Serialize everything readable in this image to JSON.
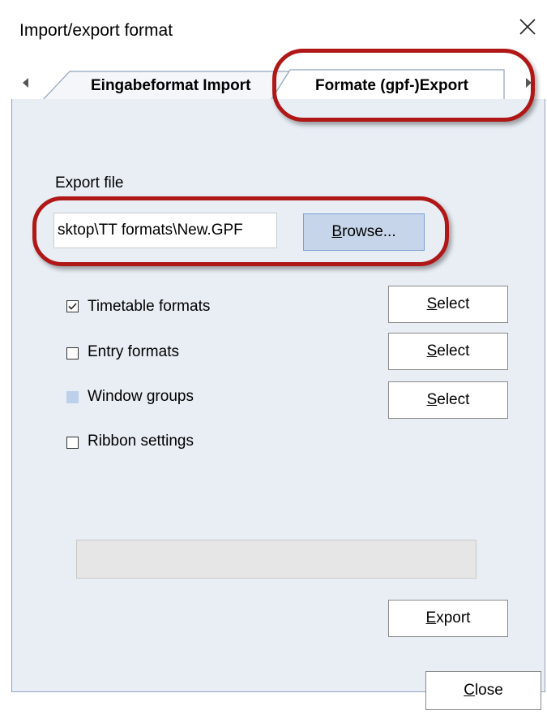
{
  "window": {
    "title": "Import/export format"
  },
  "tabs": [
    {
      "label": "Eingabeformat Import",
      "selected": false
    },
    {
      "label": "Formate (gpf-)Export",
      "selected": true
    }
  ],
  "export_file": {
    "label": "Export file",
    "value": "sktop\\TT formats\\New.GPF",
    "browse_pre": "B",
    "browse_rest": "rowse..."
  },
  "options": [
    {
      "label": "Timetable formats",
      "state": "checked",
      "has_select": true
    },
    {
      "label": "Entry formats",
      "state": "unchecked",
      "has_select": true
    },
    {
      "label": "Window groups",
      "state": "indeterminate",
      "has_select": true
    },
    {
      "label": "Ribbon settings",
      "state": "unchecked",
      "has_select": false
    }
  ],
  "select_button": {
    "pre": "S",
    "rest": "elect"
  },
  "export_button": {
    "pre": "E",
    "rest": "xport"
  },
  "close_button": {
    "pre": "C",
    "rest": "lose"
  },
  "icons": {
    "close": "close-icon",
    "tab_left": "chevron-left-icon",
    "tab_right": "chevron-right-icon",
    "check": "checkmark-icon"
  },
  "colors": {
    "panel_bg": "#e9eef5",
    "browse_bg": "#c6d5ea",
    "highlight": "#b01818"
  }
}
